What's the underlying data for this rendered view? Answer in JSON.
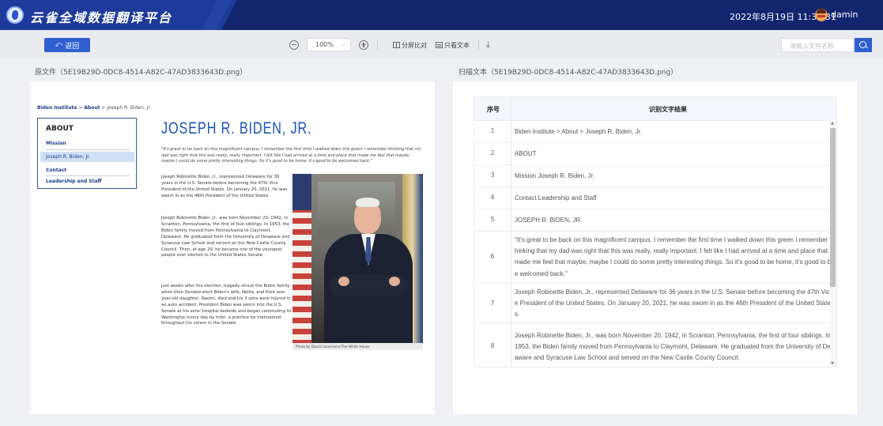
{
  "app": {
    "title": "云雀全域数据翻译平台",
    "datetime": "2022年8月19日 11:34:31",
    "user": "damin"
  },
  "toolbar": {
    "back_label": "返回",
    "zoom_value": "100%",
    "split_compare_label": "分屏比对",
    "text_only_label": "只看文本",
    "search_placeholder": "请输入文件名称"
  },
  "left_label": "原文件（5E19B29D-0DC8-4514-A82C-47AD3833643D.png）",
  "right_label": "扫描文本（5E19B29D-0DC8-4514-A82C-47AD3833643D.png）",
  "document": {
    "breadcrumb_1": "Biden Institute",
    "breadcrumb_2": "About",
    "breadcrumb_3": "Joseph R. Biden, Jr.",
    "nav_heading": "ABOUT",
    "nav_items": [
      "Mission",
      "Joseph R. Biden, Jr.",
      "Contact",
      "Leadership and Staff"
    ],
    "title": "JOSEPH R. BIDEN, JR.",
    "quote": "\"It's great to be back on this magnificent campus. I remember the first time I walked down this green I remember thinking that my dad was right that this was really, really important. I felt like I had arrived at a time and place that made me feel that maybe, maybe I could do some pretty interesting things. So it's good to be home, it's good to be welcomed back.\"",
    "para1": "Joseph Robinette Biden, Jr., represented Delaware for 36 years in the U.S. Senate before becoming the 47th Vice President of the United States. On January 20, 2021, he was sworn in as the 46th President of the United States.",
    "para2": "Joseph Robinette Biden, Jr., was born November 20, 1942, in Scranton, Pennsylvania, the first of four siblings. In 1953, the Biden family moved from Pennsylvania to Claymont, Delaware. He graduated from the University of Delaware and Syracuse Law School and served on the New Castle County Council. Then, at age 29, he became one of the youngest people ever elected to the United States Senate.",
    "para3": "Just weeks after the election, tragedy struck the Biden family when then Senator-elect Biden's wife, Neilia, and their one-year-old daughter, Naomi, died and his 2 sons were injured in an auto accident. President Biden was sworn into the U.S. Senate at his sons' hospital bedside and began commuting to Washington every day by train, a practice he maintained throughout his career in the Senate.",
    "photo_caption": "Photo by David Lienemann/The White House"
  },
  "table": {
    "col_num": "序号",
    "col_text": "识别文字结果",
    "rows": [
      {
        "num": "1",
        "text": "Biden Institute > About > Joseph R. Biden, Jr."
      },
      {
        "num": "2",
        "text": "ABOUT"
      },
      {
        "num": "3",
        "text": "Mission Joseph R. Biden, Jr."
      },
      {
        "num": "4",
        "text": "Contact Leadership and Staff"
      },
      {
        "num": "5",
        "text": "JOSEPH R. BIDEN, JR."
      },
      {
        "num": "6",
        "text": "\"It's great to be back on this magnificent campus. I remember the first time I walked down this green I remember thinking that my dad was right that this was really, really important. I felt like I had arrived at a time and place that made me feel that maybe, maybe I could do some pretty interesting things. So it's good to be home, it's good to be welcomed back.\""
      },
      {
        "num": "7",
        "text": "Joseph Robinette Biden, Jr., represented Delaware for 36 years in the U.S. Senate before becoming the 47th Vice President of the United States. On January 20, 2021, he was swom in as the 46th President of the United States."
      },
      {
        "num": "8",
        "text": "Joseph Robinette Biden, Jr., was born November 20, 1942, in Scranton, Pennsylvania, the first of four siblings. In 1953, the Biden family moved from Pennsylvania to Claymont, Delaware. He graduated from the University of Delaware and Syracuse Law School and served on the New Castle County Council."
      }
    ]
  }
}
